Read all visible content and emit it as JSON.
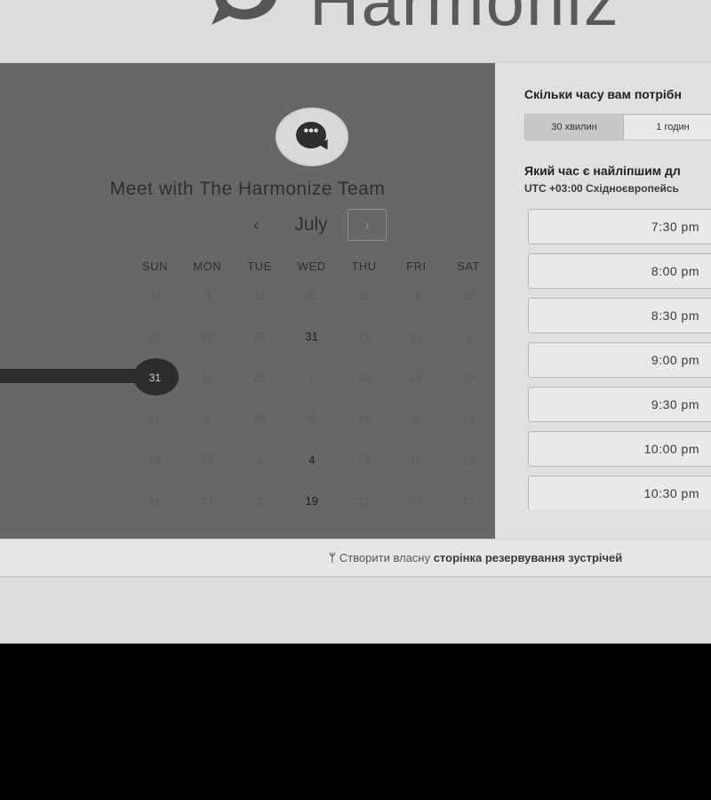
{
  "brand": {
    "name": "Harmoniz",
    "logo_icon": "chat-bubble-logo-icon"
  },
  "calendar": {
    "title": "Meet with The Harmonize Team",
    "month": "July",
    "prev_label": "‹",
    "next_label": "›",
    "weekdays": [
      "SUN",
      "MON",
      "TUE",
      "WED",
      "THU",
      "FRI",
      "SAT"
    ],
    "weeks": [
      [
        "24",
        "8",
        "18",
        "31",
        "11",
        "16",
        "24"
      ],
      [
        "20",
        "26",
        "22",
        "31",
        "19",
        "21",
        "8"
      ],
      [
        "31",
        "26",
        "25",
        "1",
        "30",
        "28",
        "30"
      ],
      [
        "21",
        "9",
        "20",
        "29",
        "15",
        "5",
        "19"
      ],
      [
        "19",
        "27",
        "8",
        "4",
        "12",
        "10",
        "18"
      ],
      [
        "16",
        "14",
        "3",
        "19",
        "21",
        "14",
        "17"
      ]
    ],
    "available_days": [
      [
        1,
        3
      ],
      [
        4,
        3
      ],
      [
        5,
        3
      ]
    ],
    "selected_day": [
      2,
      0
    ]
  },
  "scheduler": {
    "duration_question": "Скільки часу вам потрібн",
    "durations": [
      "30 хвилин",
      "1 годин"
    ],
    "selected_duration_index": 0,
    "time_question": "Який час є найліпшим дл",
    "timezone_prefix": "UTC +03:00",
    "timezone_name": "Східноєвропейсь",
    "slots": [
      "7:30 pm",
      "8:00 pm",
      "8:30 pm",
      "9:00 pm",
      "9:30 pm",
      "10:00 pm",
      "10:30 pm"
    ]
  },
  "footer": {
    "icon": "sprocket-icon",
    "text_plain": "Створити власну",
    "text_bold": "сторінка резервування зустрічей"
  },
  "colors": {
    "left_panel": "#676767",
    "selected_day": "#2c2c2c",
    "page_bg": "#dcdcdc"
  }
}
